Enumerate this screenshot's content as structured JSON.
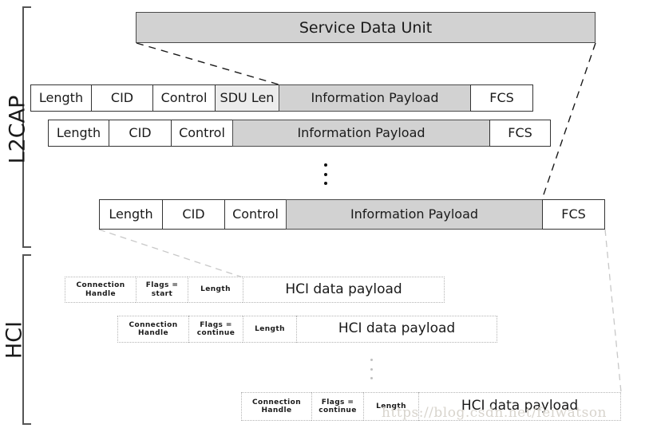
{
  "layers": {
    "l2cap": {
      "label": "L2CAP"
    },
    "hci": {
      "label": "HCI"
    }
  },
  "sdu": {
    "label": "Service Data Unit"
  },
  "l2cap_rows": [
    {
      "name": "l2cap-row-first-fragment",
      "cells": [
        {
          "label": "Length",
          "shaded": false,
          "kind": "length"
        },
        {
          "label": "CID",
          "shaded": false,
          "kind": "cid"
        },
        {
          "label": "Control",
          "shaded": false,
          "kind": "control"
        },
        {
          "label": "SDU Len",
          "shaded": false,
          "kind": "sdu-len"
        },
        {
          "label": "Information Payload",
          "shaded": true,
          "kind": "information-payload"
        },
        {
          "label": "FCS",
          "shaded": false,
          "kind": "fcs"
        }
      ]
    },
    {
      "name": "l2cap-row-continuation-fragment",
      "cells": [
        {
          "label": "Length",
          "shaded": false,
          "kind": "length"
        },
        {
          "label": "CID",
          "shaded": false,
          "kind": "cid"
        },
        {
          "label": "Control",
          "shaded": false,
          "kind": "control"
        },
        {
          "label": "Information Payload",
          "shaded": true,
          "kind": "information-payload"
        },
        {
          "label": "FCS",
          "shaded": false,
          "kind": "fcs"
        }
      ]
    },
    {
      "name": "l2cap-row-last-fragment",
      "cells": [
        {
          "label": "Length",
          "shaded": false,
          "kind": "length"
        },
        {
          "label": "CID",
          "shaded": false,
          "kind": "cid"
        },
        {
          "label": "Control",
          "shaded": false,
          "kind": "control"
        },
        {
          "label": "Information Payload",
          "shaded": true,
          "kind": "information-payload"
        },
        {
          "label": "FCS",
          "shaded": false,
          "kind": "fcs"
        }
      ]
    }
  ],
  "hci_rows": [
    {
      "name": "hci-row-start",
      "cells": [
        {
          "label": "Connection\nHandle",
          "kind": "connection-handle"
        },
        {
          "label": "Flags =\nstart",
          "kind": "flags"
        },
        {
          "label": "Length",
          "kind": "length"
        },
        {
          "label": "HCI data payload",
          "kind": "hci-data-payload"
        }
      ]
    },
    {
      "name": "hci-row-continue-1",
      "cells": [
        {
          "label": "Connection\nHandle",
          "kind": "connection-handle"
        },
        {
          "label": "Flags =\ncontinue",
          "kind": "flags"
        },
        {
          "label": "Length",
          "kind": "length"
        },
        {
          "label": "HCI data payload",
          "kind": "hci-data-payload"
        }
      ]
    },
    {
      "name": "hci-row-continue-last",
      "cells": [
        {
          "label": "Connection\nHandle",
          "kind": "connection-handle"
        },
        {
          "label": "Flags =\ncontinue",
          "kind": "flags"
        },
        {
          "label": "Length",
          "kind": "length"
        },
        {
          "label": "HCI data payload",
          "kind": "hci-data-payload"
        }
      ]
    }
  ],
  "ellipsis": {
    "l2cap_dots": "•••",
    "hci_dots": "•••"
  },
  "watermark": {
    "text": "https://blog.csdn.net/feiwatson"
  },
  "colors": {
    "shaded_fill": "#d2d2d2",
    "sdu_len_fill": "#ececec",
    "l2cap_border": "#333333",
    "hci_border": "#b4b4b4",
    "text": "#1a1a1a",
    "bracket": "#555555",
    "watermark": "#d8d4cd"
  }
}
